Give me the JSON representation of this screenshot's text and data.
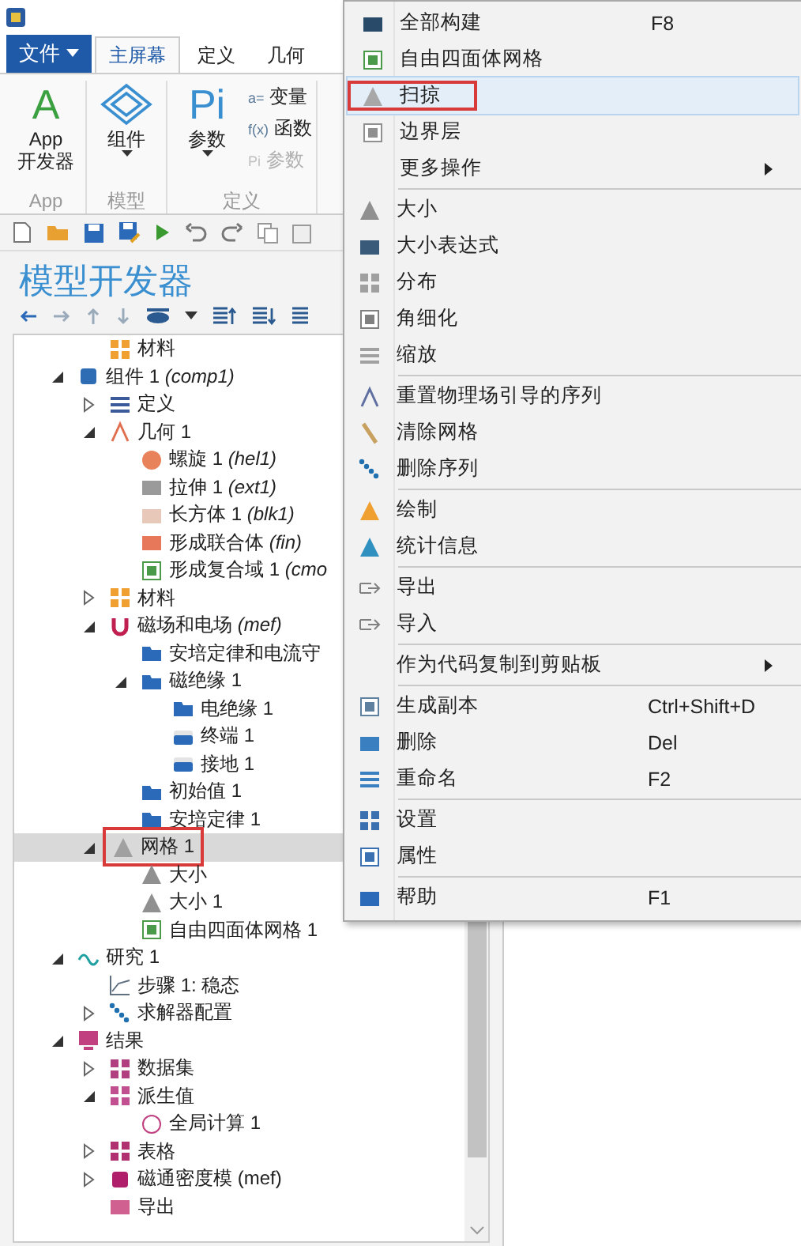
{
  "file_button": {
    "label": "文件"
  },
  "tabs": [
    {
      "label": "主屏幕",
      "selected": true
    },
    {
      "label": "定义",
      "selected": false
    },
    {
      "label": "几何",
      "selected": false
    }
  ],
  "ribbon": {
    "groups": [
      {
        "label": "App",
        "buttons": [
          {
            "glyph": "A",
            "color": "#3aa040",
            "label": "App 开发器",
            "dropdown": false
          }
        ]
      },
      {
        "label": "模型",
        "buttons": [
          {
            "label": "组件",
            "dropdown": true
          }
        ]
      },
      {
        "label": "定义",
        "buttons": [
          {
            "glyph": "Pi",
            "color": "#3a8fd0",
            "label": "参数",
            "dropdown": true
          }
        ],
        "small_buttons": [
          {
            "glyph": "a=",
            "label": "变量",
            "disabled": false
          },
          {
            "glyph": "f(x)",
            "label": "函数",
            "disabled": false
          },
          {
            "glyph": "Pi",
            "label": "参数",
            "disabled": true
          }
        ]
      }
    ]
  },
  "model_builder": {
    "title": "模型开发器",
    "tree": [
      {
        "children": [
          {
            "label": "材料",
            "kind": "material",
            "selected": false,
            "highlighted": false
          }
        ]
      },
      {
        "label": "组件 1",
        "tag": "(comp1)",
        "kind": "component",
        "expanded": true,
        "selected": false,
        "highlighted": false,
        "children": [
          {
            "label": "定义",
            "kind": "definitions",
            "expanded": false,
            "selected": false,
            "highlighted": false
          },
          {
            "label": "几何 1",
            "kind": "geometry",
            "expanded": true,
            "selected": false,
            "highlighted": false,
            "children": [
              {
                "label": "螺旋 1",
                "tag": "(hel1)",
                "kind": "helix",
                "selected": false,
                "highlighted": false
              },
              {
                "label": "拉伸 1",
                "tag": "(ext1)",
                "kind": "extrude",
                "selected": false,
                "highlighted": false
              },
              {
                "label": "长方体 1",
                "tag": "(blk1)",
                "kind": "block",
                "selected": false,
                "highlighted": false
              },
              {
                "label": "形成联合体",
                "tag": "(fin)",
                "kind": "union",
                "selected": false,
                "highlighted": false
              },
              {
                "label": "形成复合域 1",
                "tag": "(cmo",
                "kind": "assembly",
                "selected": false,
                "highlighted": false
              }
            ]
          },
          {
            "label": "材料",
            "kind": "material",
            "expanded": false,
            "selected": false,
            "highlighted": false
          },
          {
            "label": "磁场和电场",
            "tag": "(mef)",
            "kind": "physics",
            "expanded": true,
            "selected": false,
            "highlighted": false,
            "children": [
              {
                "label": "安培定律和电流守",
                "kind": "domain",
                "selected": false,
                "highlighted": false
              },
              {
                "label": "磁绝缘 1",
                "kind": "domain",
                "expanded": true,
                "selected": false,
                "highlighted": false,
                "children": [
                  {
                    "label": "电绝缘 1",
                    "kind": "domain",
                    "selected": false,
                    "highlighted": false
                  },
                  {
                    "label": "终端 1",
                    "kind": "boundary",
                    "selected": false,
                    "highlighted": false
                  },
                  {
                    "label": "接地 1",
                    "kind": "boundary",
                    "selected": false,
                    "highlighted": false
                  }
                ]
              },
              {
                "label": "初始值 1",
                "kind": "domain",
                "selected": false,
                "highlighted": false
              },
              {
                "label": "安培定律 1",
                "kind": "domain",
                "selected": false,
                "highlighted": false
              }
            ]
          },
          {
            "label": "网格 1",
            "kind": "mesh",
            "expanded": true,
            "selected": true,
            "highlighted": true,
            "children": [
              {
                "label": "大小",
                "kind": "size",
                "selected": false,
                "highlighted": false
              },
              {
                "label": "大小 1",
                "kind": "size",
                "selected": false,
                "highlighted": false
              },
              {
                "label": "自由四面体网格 1",
                "kind": "tetra",
                "selected": false,
                "highlighted": false
              }
            ]
          }
        ]
      },
      {
        "label": "研究 1",
        "kind": "study",
        "expanded": true,
        "selected": false,
        "highlighted": false,
        "children": [
          {
            "label": "步骤 1: 稳态",
            "kind": "step",
            "selected": false,
            "highlighted": false
          },
          {
            "label": "求解器配置",
            "kind": "solver",
            "expanded": false,
            "selected": false,
            "highlighted": false
          }
        ]
      },
      {
        "label": "结果",
        "kind": "results",
        "expanded": true,
        "selected": false,
        "highlighted": false,
        "children": [
          {
            "label": "数据集",
            "kind": "dataset",
            "expanded": false,
            "selected": false,
            "highlighted": false
          },
          {
            "label": "派生值",
            "kind": "derived",
            "expanded": true,
            "selected": false,
            "highlighted": false,
            "children": [
              {
                "label": "全局计算 1",
                "kind": "eval",
                "selected": false,
                "highlighted": false
              }
            ]
          },
          {
            "label": "表格",
            "kind": "table",
            "expanded": false,
            "selected": false,
            "highlighted": false
          },
          {
            "label": "磁通密度模 (mef)",
            "kind": "plot",
            "expanded": false,
            "selected": false,
            "highlighted": false
          },
          {
            "label": "导出",
            "kind": "export",
            "selected": false,
            "highlighted": false
          }
        ]
      }
    ]
  },
  "context_menu": {
    "groups": [
      {
        "items": [
          {
            "label": "全部构建",
            "shortcut": "F8",
            "kind": "build",
            "submenu": false,
            "hovered": false,
            "highlighted": false
          },
          {
            "label": "自由四面体网格",
            "kind": "tetra",
            "submenu": false,
            "hovered": false,
            "highlighted": false
          },
          {
            "label": "扫掠",
            "kind": "sweep",
            "submenu": false,
            "hovered": true,
            "highlighted": true
          },
          {
            "label": "边界层",
            "kind": "layer",
            "submenu": false,
            "hovered": false,
            "highlighted": false
          },
          {
            "label": "更多操作",
            "submenu": true,
            "hovered": false,
            "highlighted": false
          }
        ]
      },
      {
        "items": [
          {
            "label": "大小",
            "kind": "size",
            "submenu": false,
            "hovered": false,
            "highlighted": false
          },
          {
            "label": "大小表达式",
            "kind": "sizeexpr",
            "submenu": false,
            "hovered": false,
            "highlighted": false
          },
          {
            "label": "分布",
            "kind": "distribution",
            "submenu": false,
            "hovered": false,
            "highlighted": false
          },
          {
            "label": "角细化",
            "kind": "corner",
            "submenu": false,
            "hovered": false,
            "highlighted": false
          },
          {
            "label": "缩放",
            "kind": "scale",
            "submenu": false,
            "hovered": false,
            "highlighted": false
          }
        ]
      },
      {
        "items": [
          {
            "label": "重置物理场引导的序列",
            "kind": "reset",
            "submenu": false,
            "hovered": false,
            "highlighted": false
          },
          {
            "label": "清除网格",
            "kind": "clear",
            "submenu": false,
            "hovered": false,
            "highlighted": false
          },
          {
            "label": "删除序列",
            "kind": "solver",
            "submenu": false,
            "hovered": false,
            "highlighted": false
          }
        ]
      },
      {
        "items": [
          {
            "label": "绘制",
            "kind": "plotmesh",
            "submenu": false,
            "hovered": false,
            "highlighted": false
          },
          {
            "label": "统计信息",
            "kind": "stats",
            "submenu": false,
            "hovered": false,
            "highlighted": false
          }
        ]
      },
      {
        "items": [
          {
            "label": "导出",
            "kind": "arrow",
            "submenu": false,
            "hovered": false,
            "highlighted": false
          },
          {
            "label": "导入",
            "kind": "arrow",
            "submenu": false,
            "hovered": false,
            "highlighted": false
          }
        ]
      },
      {
        "items": [
          {
            "label": "作为代码复制到剪贴板",
            "submenu": true,
            "hovered": false,
            "highlighted": false
          }
        ]
      },
      {
        "items": [
          {
            "label": "生成副本",
            "shortcut": "Ctrl+Shift+D",
            "kind": "duplicate",
            "submenu": false,
            "hovered": false,
            "highlighted": false
          },
          {
            "label": "删除",
            "shortcut": "Del",
            "kind": "delete",
            "submenu": false,
            "hovered": false,
            "highlighted": false
          },
          {
            "label": "重命名",
            "shortcut": "F2",
            "kind": "rename",
            "submenu": false,
            "hovered": false,
            "highlighted": false
          }
        ]
      },
      {
        "items": [
          {
            "label": "设置",
            "kind": "settings",
            "submenu": false,
            "hovered": false,
            "highlighted": false
          },
          {
            "label": "属性",
            "kind": "properties",
            "submenu": false,
            "hovered": false,
            "highlighted": false
          }
        ]
      },
      {
        "items": [
          {
            "label": "帮助",
            "shortcut": "F1",
            "kind": "help",
            "submenu": false,
            "hovered": false,
            "highlighted": false
          }
        ]
      }
    ]
  }
}
